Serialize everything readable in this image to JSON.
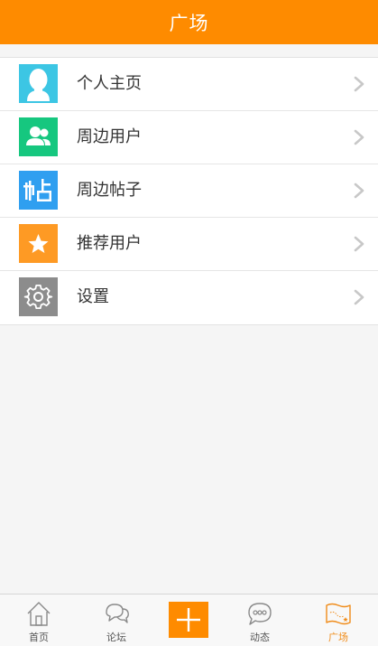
{
  "header": {
    "title": "广场"
  },
  "menu": {
    "items": [
      {
        "label": "个人主页",
        "icon": "person-icon",
        "color": "#3cc6e4"
      },
      {
        "label": "周边用户",
        "icon": "users-icon",
        "color": "#16c77f"
      },
      {
        "label": "周边帖子",
        "icon": "post-icon",
        "color": "#2f9ff0"
      },
      {
        "label": "推荐用户",
        "icon": "star-icon",
        "color": "#fe9a24"
      },
      {
        "label": "设置",
        "icon": "gear-icon",
        "color": "#8c8c8c"
      }
    ]
  },
  "tabbar": {
    "tabs": [
      {
        "label": "首页",
        "icon": "home-icon"
      },
      {
        "label": "论坛",
        "icon": "chat-bubbles-icon"
      },
      {
        "label": "",
        "icon": "plus-icon"
      },
      {
        "label": "动态",
        "icon": "speech-bubble-icon"
      },
      {
        "label": "广场",
        "icon": "map-icon",
        "active": true
      }
    ]
  },
  "colors": {
    "accent": "#fe8b00",
    "background": "#f5f5f5"
  }
}
